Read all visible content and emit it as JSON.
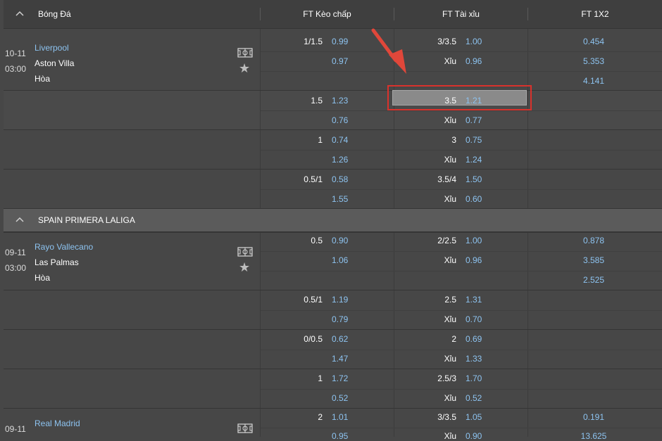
{
  "header": {
    "sport": "Bóng Đá",
    "col_handicap": "FT Kèo chấp",
    "col_overunder": "FT Tài xỉu",
    "col_1x2": "FT 1X2"
  },
  "sections": [
    {
      "name": "SPAIN PRIMERA LALIGA"
    }
  ],
  "matches": [
    {
      "date": "10-11",
      "time": "03:00",
      "home": "Liverpool",
      "away": "Aston Villa",
      "draw": "Hòa",
      "x12": [
        "0.454",
        "5.353",
        "4.141"
      ],
      "lines": [
        {
          "hcap": "1/1.5",
          "h1": "0.99",
          "h2": "0.97",
          "ou": "3/3.5",
          "ou_under": "Xỉu",
          "o1": "1.00",
          "o2": "0.96"
        },
        {
          "hcap": "1.5",
          "h1": "1.23",
          "h2": "0.76",
          "ou": "3.5",
          "ou_under": "Xỉu",
          "o1": "1.21",
          "o2": "0.77"
        },
        {
          "hcap": "1",
          "h1": "0.74",
          "h2": "1.26",
          "ou": "3",
          "ou_under": "Xỉu",
          "o1": "0.75",
          "o2": "1.24"
        },
        {
          "hcap": "0.5/1",
          "h1": "0.58",
          "h2": "1.55",
          "ou": "3.5/4",
          "ou_under": "Xỉu",
          "o1": "1.50",
          "o2": "0.60"
        }
      ]
    },
    {
      "date": "09-11",
      "time": "03:00",
      "home": "Rayo Vallecano",
      "away": "Las Palmas",
      "draw": "Hòa",
      "x12": [
        "0.878",
        "3.585",
        "2.525"
      ],
      "lines": [
        {
          "hcap": "0.5",
          "h1": "0.90",
          "h2": "1.06",
          "ou": "2/2.5",
          "ou_under": "Xỉu",
          "o1": "1.00",
          "o2": "0.96"
        },
        {
          "hcap": "0.5/1",
          "h1": "1.19",
          "h2": "0.79",
          "ou": "2.5",
          "ou_under": "Xỉu",
          "o1": "1.31",
          "o2": "0.70"
        },
        {
          "hcap": "0/0.5",
          "h1": "0.62",
          "h2": "1.47",
          "ou": "2",
          "ou_under": "Xỉu",
          "o1": "0.69",
          "o2": "1.33"
        },
        {
          "hcap": "1",
          "h1": "1.72",
          "h2": "0.52",
          "ou": "2.5/3",
          "ou_under": "Xỉu",
          "o1": "1.70",
          "o2": "0.52"
        }
      ]
    },
    {
      "date": "09-11",
      "home": "Real Madrid",
      "x12": [
        "0.191",
        "13.625"
      ],
      "lines": [
        {
          "hcap": "2",
          "h1": "1.01",
          "h2": "0.95",
          "ou": "3/3.5",
          "ou_under": "Xỉu",
          "o1": "1.05",
          "o2": "0.90"
        }
      ]
    }
  ],
  "icons": {
    "chevron": "chevron-up-icon",
    "field": "soccer-field-icon",
    "star": "favorite-star-icon"
  },
  "colors": {
    "background": "#474747",
    "section": "#5b5b5b",
    "odds": "#8dc3f0",
    "highlight_border": "#d9322c",
    "highlight_fill": "#8a8a8a",
    "arrow": "#e0473a"
  }
}
